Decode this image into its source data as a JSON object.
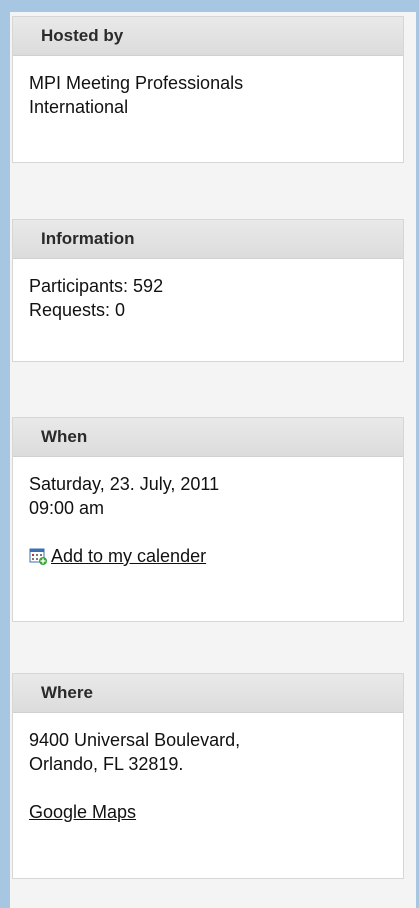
{
  "hosted_by": {
    "title": "Hosted by",
    "line1": "MPI Meeting Professionals",
    "line2": "International"
  },
  "information": {
    "title": "Information",
    "participants": "Participants: 592",
    "requests": "Requests: 0"
  },
  "when": {
    "title": "When",
    "date": "Saturday, 23. July, 2011",
    "time": "09:00 am",
    "calendar_link": "Add to my calender",
    "calendar_icon": "calendar-add-icon"
  },
  "where": {
    "title": "Where",
    "address1": "9400 Universal Boulevard,",
    "address2": "Orlando, FL 32819.",
    "maps_link": "Google Maps"
  },
  "colors": {
    "frame_blue": "#a6c6e2",
    "header_bg": "#e2e2e2",
    "panel_bg": "#ffffff"
  }
}
